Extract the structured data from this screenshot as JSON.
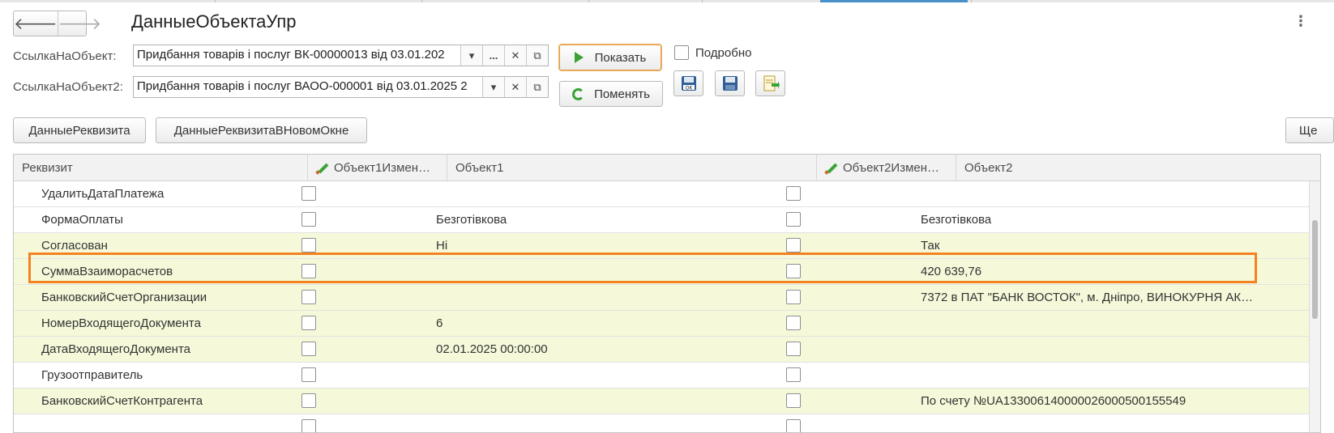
{
  "window": {
    "title": "ДанныеОбъектаУпр",
    "more_menu": "⋮"
  },
  "nav": {
    "back": "🡐",
    "forward": "🡒"
  },
  "form": {
    "field1_label": "СсылкаНаОбъект:",
    "field1_value": "Придбання товарів і послуг ВК-00000013 від 03.01.202",
    "field2_label": "СсылкаНаОбъект2:",
    "field2_value": "Придбання товарів і послуг ВАОО-000001 від 03.01.2025 2",
    "dropdown_glyph": "▾",
    "select_glyph": "...",
    "clear_glyph": "✕",
    "open_glyph": "⧉",
    "show_button": "Показать",
    "swap_button": "Поменять",
    "detail_label": "Подробно"
  },
  "toolbar": {
    "requisite_data": "ДанныеРеквизита",
    "requisite_data_new_window": "ДанныеРеквизитаВНовомОкне",
    "more": "Ще"
  },
  "table": {
    "columns": [
      "Реквизит",
      "Объект1Измен…",
      "Объект1",
      "Объект2Измен…",
      "Объект2"
    ],
    "rows": [
      {
        "name": "УдалитьДатаПлатежа",
        "obj1": "",
        "obj2": "",
        "highlight": false
      },
      {
        "name": "ФормаОплаты",
        "obj1": "Безготівкова",
        "obj2": "Безготівкова",
        "highlight": false
      },
      {
        "name": "Согласован",
        "obj1": "Ні",
        "obj2": "Так",
        "highlight": true
      },
      {
        "name": "СуммаВзаиморасчетов",
        "obj1": "",
        "obj2": "420 639,76",
        "highlight": true
      },
      {
        "name": "БанковскийСчетОрганизации",
        "obj1": "",
        "obj2": "7372 в ПАТ \"БАНК ВОСТОК\", м. Дніпро, ВИНОКУРНЯ АК…",
        "highlight": true
      },
      {
        "name": "НомерВходящегоДокумента",
        "obj1": "6",
        "obj2": "",
        "highlight": true
      },
      {
        "name": "ДатаВходящегоДокумента",
        "obj1": "02.01.2025 00:00:00",
        "obj2": "",
        "highlight": true
      },
      {
        "name": "Грузоотправитель",
        "obj1": "",
        "obj2": "",
        "highlight": false
      },
      {
        "name": "БанковскийСчетКонтрагента",
        "obj1": "",
        "obj2": "По счету №UA133006140000026000500155549",
        "highlight": true
      },
      {
        "name": "",
        "obj1": "",
        "obj2": "",
        "highlight": false
      }
    ]
  },
  "colors": {
    "row_highlight": "#f5f9d9",
    "annotation": "#f58220",
    "accent_green": "#3aa335"
  }
}
